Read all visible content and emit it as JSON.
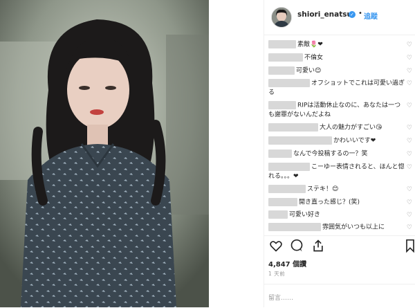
{
  "post": {
    "username": "shiori_enatsu",
    "separator": "•",
    "follow_label": "追蹤",
    "likes_text": "4,847 個讚",
    "time_text": "1 天前",
    "add_comment_placeholder": "留言……"
  },
  "comments": [
    {
      "text": "素敵🌷❤"
    },
    {
      "text": "不倫女"
    },
    {
      "text": "可愛い😊"
    },
    {
      "text": "オフショットでこれは可愛い過ぎる"
    },
    {
      "text": "RIPは活動休止なのに、あなたは一つも謝罪がないんだよね"
    },
    {
      "text": "大人の魅力がすごい😘"
    },
    {
      "text": "かわいいです❤"
    },
    {
      "text": "なんで今投稿するの一？笑"
    },
    {
      "text": "こーゆー表情されると、ほんと惚れる。。。❤"
    },
    {
      "text": "ステキ！😊"
    },
    {
      "text": "開き直った感じ？(笑)"
    },
    {
      "text": "可愛い好き"
    },
    {
      "text": "雰囲気がいつも以上に"
    }
  ],
  "icons": [
    "verified-icon",
    "heart-icon",
    "comment-icon",
    "share-icon",
    "bookmark-icon",
    "like-comment-icon"
  ],
  "colors": {
    "accent": "#3897f0",
    "text": "#262626",
    "muted": "#999999",
    "border": "#efefef"
  }
}
